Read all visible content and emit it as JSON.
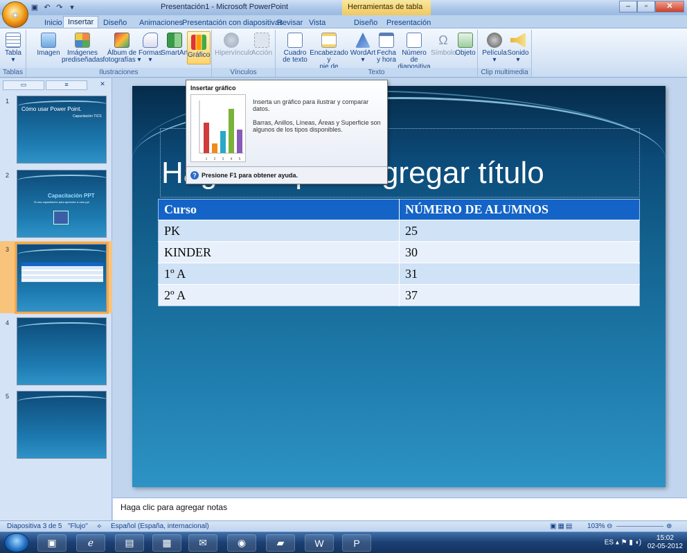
{
  "window": {
    "title": "Presentación1 - Microsoft PowerPoint",
    "context_title": "Herramientas de tabla"
  },
  "tabs": [
    "Inicio",
    "Insertar",
    "Diseño",
    "Animaciones",
    "Presentación con diapositivas",
    "Revisar",
    "Vista",
    "Diseño",
    "Presentación"
  ],
  "active_tab": "Insertar",
  "ribbon": {
    "groups": {
      "tablas": "Tablas",
      "ilustraciones": "Ilustraciones",
      "vinculos": "Vínculos",
      "texto": "Texto",
      "multimedia": "Clip multimedia"
    },
    "buttons": {
      "tabla": "Tabla",
      "imagen": "Imagen",
      "imagenes1": "Imágenes",
      "imagenes2": "prediseñadas",
      "album1": "Álbum de",
      "album2": "fotografías",
      "formas": "Formas",
      "smartart": "SmartArt",
      "grafico": "Gráfico",
      "hipervinculo": "Hipervínculo",
      "accion": "Acción",
      "cuadro1": "Cuadro",
      "cuadro2": "de texto",
      "encab1": "Encabezado y",
      "encab2": "pie de página",
      "wordart": "WordArt",
      "fecha1": "Fecha",
      "fecha2": "y hora",
      "numero1": "Número de",
      "numero2": "diapositiva",
      "simbolo": "Símbolo",
      "objeto": "Objeto",
      "pelicula": "Película",
      "sonido": "Sonido"
    }
  },
  "tooltip": {
    "title": "Insertar gráfico",
    "desc1": "Inserta un gráfico para ilustrar y comparar datos.",
    "desc2": "Barras, Anillos, Líneas, Áreas y Superficie son algunos de los tipos disponibles.",
    "help": "Presione F1 para obtener ayuda.",
    "chart_axis": [
      "1",
      "2",
      "3",
      "4",
      "5"
    ]
  },
  "slides": [
    {
      "num": "1",
      "title": "Cómo usar Power Point.",
      "subtitle": "Capacitación TICS"
    },
    {
      "num": "2",
      "title": "Capacitación PPT",
      "subtitle": "Si una capacitación para aprender a usar ppt"
    },
    {
      "num": "3"
    },
    {
      "num": "4"
    },
    {
      "num": "5"
    }
  ],
  "slide": {
    "title": "Haga clic para agregar título",
    "table": {
      "headers": [
        "Curso",
        "NÚMERO DE ALUMNOS"
      ],
      "rows": [
        [
          "PK",
          "25"
        ],
        [
          "KINDER",
          "30"
        ],
        [
          "1º A",
          "31"
        ],
        [
          "2º A",
          "37"
        ]
      ]
    }
  },
  "notes": "Haga clic para agregar notas",
  "status": {
    "slide": "Diapositiva 3 de 5",
    "theme": "\"Flujo\"",
    "language": "Español (España, internacional)",
    "zoom": "103%"
  },
  "tray": {
    "lang": "ES",
    "time": "15:02",
    "date": "02-05-2012"
  }
}
